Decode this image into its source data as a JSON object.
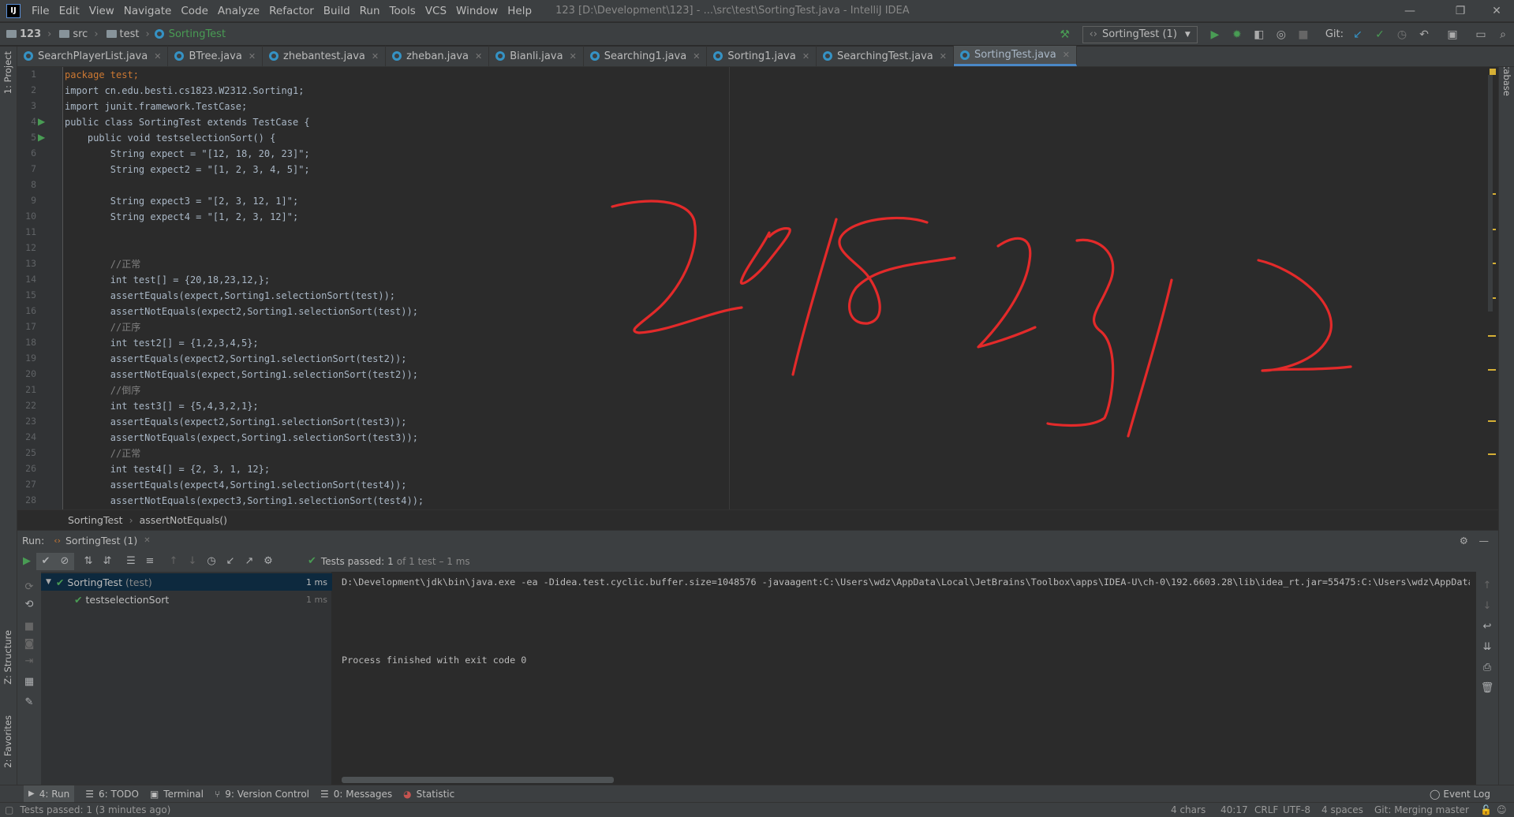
{
  "app": {
    "logo": "IJ",
    "title": "123 [D:\\Development\\123] - ...\\src\\test\\SortingTest.java - IntelliJ IDEA"
  },
  "menu": [
    "File",
    "Edit",
    "View",
    "Navigate",
    "Code",
    "Analyze",
    "Refactor",
    "Build",
    "Run",
    "Tools",
    "VCS",
    "Window",
    "Help"
  ],
  "breadcrumbs": {
    "project": "123",
    "dir1": "src",
    "dir2": "test",
    "file": "SortingTest"
  },
  "toolbar": {
    "run_config": "SortingTest (1)",
    "git_label": "Git:"
  },
  "tabs": [
    "SearchPlayerList.java",
    "BTree.java",
    "zhebantest.java",
    "zheban.java",
    "Bianli.java",
    "Searching1.java",
    "Sorting1.java",
    "SearchingTest.java",
    "SortingTest.java"
  ],
  "active_tab": "SortingTest.java",
  "left_tools": {
    "project": "1: Project",
    "structure": "Z: Structure",
    "favorites": "2: Favorites"
  },
  "right_tools": {
    "database": "Database"
  },
  "code_lines": [
    "package test;",
    "import cn.edu.besti.cs1823.W2312.Sorting1;",
    "import junit.framework.TestCase;",
    "public class SortingTest extends TestCase {",
    "    public void testselectionSort() {",
    "        String expect = \"[12, 18, 20, 23]\";",
    "        String expect2 = \"[1, 2, 3, 4, 5]\";",
    "",
    "        String expect3 = \"[2, 3, 12, 1]\";",
    "        String expect4 = \"[1, 2, 3, 12]\";",
    "",
    "",
    "        //正常",
    "        int test[] = {20,18,23,12,};",
    "        assertEquals(expect,Sorting1.selectionSort(test));",
    "        assertNotEquals(expect2,Sorting1.selectionSort(test));",
    "        //正序",
    "        int test2[] = {1,2,3,4,5};",
    "        assertEquals(expect2,Sorting1.selectionSort(test2));",
    "        assertNotEquals(expect,Sorting1.selectionSort(test2));",
    "        //倒序",
    "        int test3[] = {5,4,3,2,1};",
    "        assertEquals(expect2,Sorting1.selectionSort(test3));",
    "        assertNotEquals(expect,Sorting1.selectionSort(test3));",
    "        //正常",
    "        int test4[] = {2, 3, 1, 12};",
    "        assertEquals(expect4,Sorting1.selectionSort(test4));",
    "        assertNotEquals(expect3,Sorting1.selectionSort(test4));"
  ],
  "line_numbers": [
    "1",
    "2",
    "3",
    "4",
    "5",
    "6",
    "7",
    "8",
    "9",
    "10",
    "11",
    "12",
    "13",
    "14",
    "15",
    "16",
    "17",
    "18",
    "19",
    "20",
    "21",
    "22",
    "23",
    "24",
    "25",
    "26",
    "27",
    "28"
  ],
  "editor_breadcrumb": {
    "class": "SortingTest",
    "method": "assertNotEquals()"
  },
  "handwriting": {
    "text": "20182312"
  },
  "run_panel": {
    "label": "Run:",
    "config_tab": "SortingTest (1)",
    "status": "Tests passed:",
    "status_count": "1",
    "status_suffix": "of 1 test – 1 ms",
    "tree": [
      {
        "name": "SortingTest",
        "suffix": "(test)",
        "time": "1 ms"
      },
      {
        "name": "testselectionSort",
        "suffix": "",
        "time": "1 ms"
      }
    ],
    "console_cmd": "D:\\Development\\jdk\\bin\\java.exe -ea -Didea.test.cyclic.buffer.size=1048576 -javaagent:C:\\Users\\wdz\\AppData\\Local\\JetBrains\\Toolbox\\apps\\IDEA-U\\ch-0\\192.6603.28\\lib\\idea_rt.jar=55475:C:\\Users\\wdz\\AppData\\Lo",
    "console_exit": "Process finished with exit code 0"
  },
  "bottom_tools": [
    {
      "icon": "run-icon",
      "label": "4: Run"
    },
    {
      "icon": "todo-icon",
      "label": "6: TODO"
    },
    {
      "icon": "terminal-icon",
      "label": "Terminal"
    },
    {
      "icon": "vcs-icon",
      "label": "9: Version Control"
    },
    {
      "icon": "messages-icon",
      "label": "0: Messages"
    },
    {
      "icon": "statistic-icon",
      "label": "Statistic"
    }
  ],
  "event_log": "Event Log",
  "status": {
    "message": "Tests passed: 1 (3 minutes ago)",
    "chars": "4 chars",
    "position": "40:17",
    "line_sep": "CRLF",
    "encoding": "UTF-8",
    "indent": "4 spaces",
    "git": "Git: Merging master"
  },
  "colors": {
    "accent": "#4a88c7",
    "ink": "#e32a2a",
    "pass": "#499c54"
  }
}
